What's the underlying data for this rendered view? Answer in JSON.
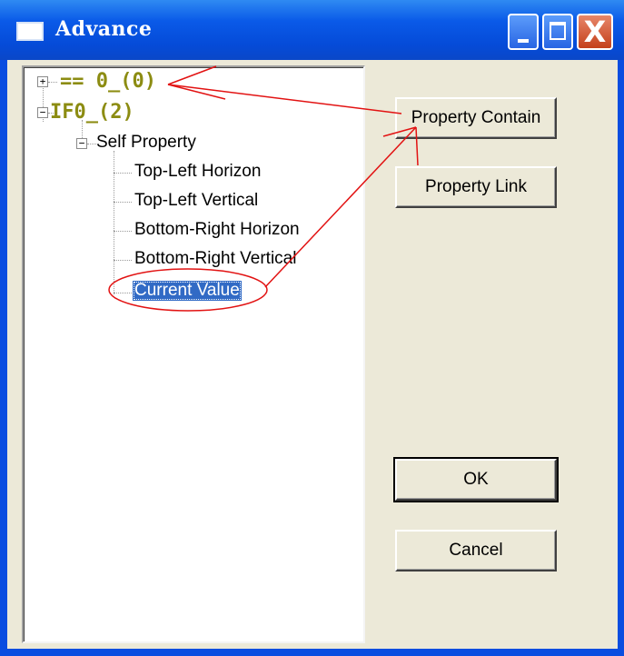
{
  "window": {
    "title": "Advance",
    "caption_buttons": {
      "minimize": "_",
      "maximize": "□",
      "close": "X"
    }
  },
  "tree": {
    "nodes": [
      {
        "label": "== 0_(0)",
        "expander": "+"
      },
      {
        "label": "IF0_(2)",
        "expander": "−"
      },
      {
        "label": "Self Property",
        "expander": "−"
      },
      {
        "label": "Top-Left Horizon"
      },
      {
        "label": "Top-Left Vertical"
      },
      {
        "label": "Bottom-Right Horizon"
      },
      {
        "label": "Bottom-Right Vertical"
      },
      {
        "label": "Current Value",
        "selected": true
      }
    ]
  },
  "buttons": {
    "property_contain": "Property Contain",
    "property_link": "Property Link",
    "ok": "OK",
    "cancel": "Cancel"
  },
  "colors": {
    "titlebar": "#0a5ae8",
    "dialog_bg": "#ece9d8",
    "olive_node": "#8c8c12",
    "selection": "#316ac5",
    "annotation": "#e21212"
  }
}
